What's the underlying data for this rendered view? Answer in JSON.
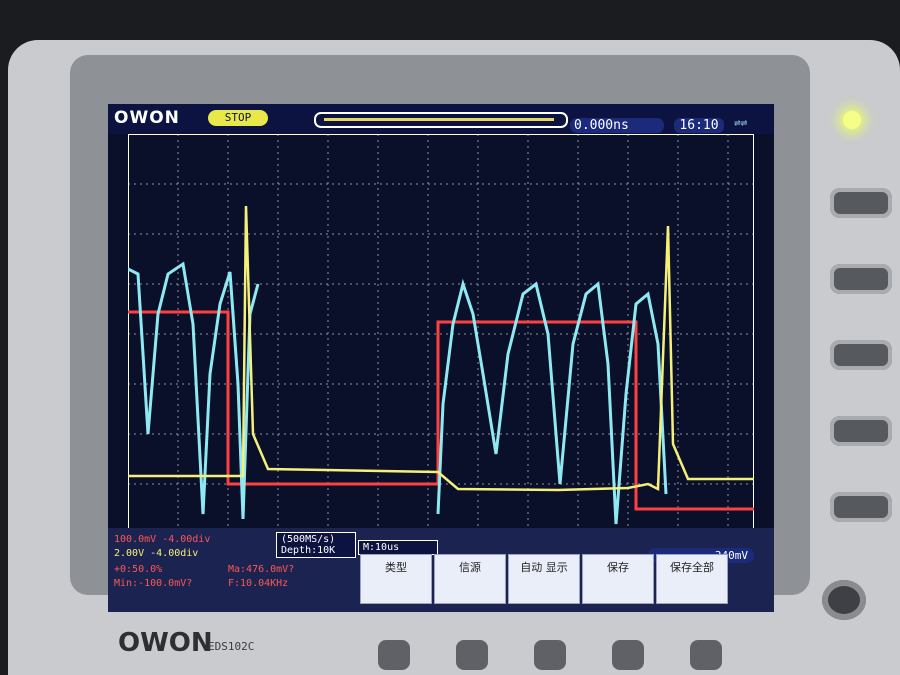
{
  "header": {
    "brand_logo": "OWON",
    "status_tag": "STOP",
    "trigger_time": "0.000ns",
    "clock": "16:10"
  },
  "channels": {
    "ch1": {
      "label": "100.0mV",
      "offset": "-4.00div",
      "color": "#ff4040"
    },
    "ch2": {
      "label": "2.00V",
      "offset": "-4.00div",
      "color": "#f5f07a"
    },
    "ch3_color": "#8fe9f2"
  },
  "measure": {
    "line1": "+0:50.0%",
    "line2": "Min:-100.0mV?",
    "line3": "Ma:476.0mV?",
    "line4": "F:10.04KHz"
  },
  "acq": {
    "sample_rate": "(500MS/s)",
    "depth": "Depth:10K",
    "timebase": "M:10us"
  },
  "trigger": {
    "level": "340mV"
  },
  "menu": [
    {
      "label": "类型"
    },
    {
      "label": "信源"
    },
    {
      "label": "自动 显示"
    },
    {
      "label": "保存"
    },
    {
      "label": "保存全部"
    }
  ],
  "device": {
    "brand": "OWON",
    "model": "EDS102C"
  }
}
